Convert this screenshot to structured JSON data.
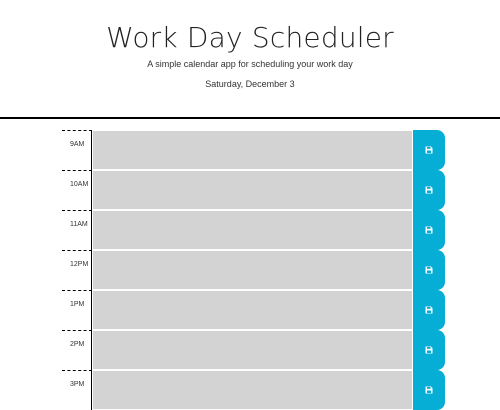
{
  "header": {
    "title": "Work Day Scheduler",
    "subtitle": "A simple calendar app for scheduling your work day",
    "current_day": "Saturday, December 3"
  },
  "time_blocks": [
    {
      "hour": "9AM",
      "text": "",
      "status": "past"
    },
    {
      "hour": "10AM",
      "text": "",
      "status": "past"
    },
    {
      "hour": "11AM",
      "text": "",
      "status": "past"
    },
    {
      "hour": "12PM",
      "text": "",
      "status": "past"
    },
    {
      "hour": "1PM",
      "text": "",
      "status": "past"
    },
    {
      "hour": "2PM",
      "text": "",
      "status": "past"
    },
    {
      "hour": "3PM",
      "text": "",
      "status": "past"
    }
  ],
  "save_button": {
    "icon": "save-icon"
  },
  "colors": {
    "past": "#d3d3d3",
    "save_button": "#06aed5",
    "divider": "#000000"
  }
}
